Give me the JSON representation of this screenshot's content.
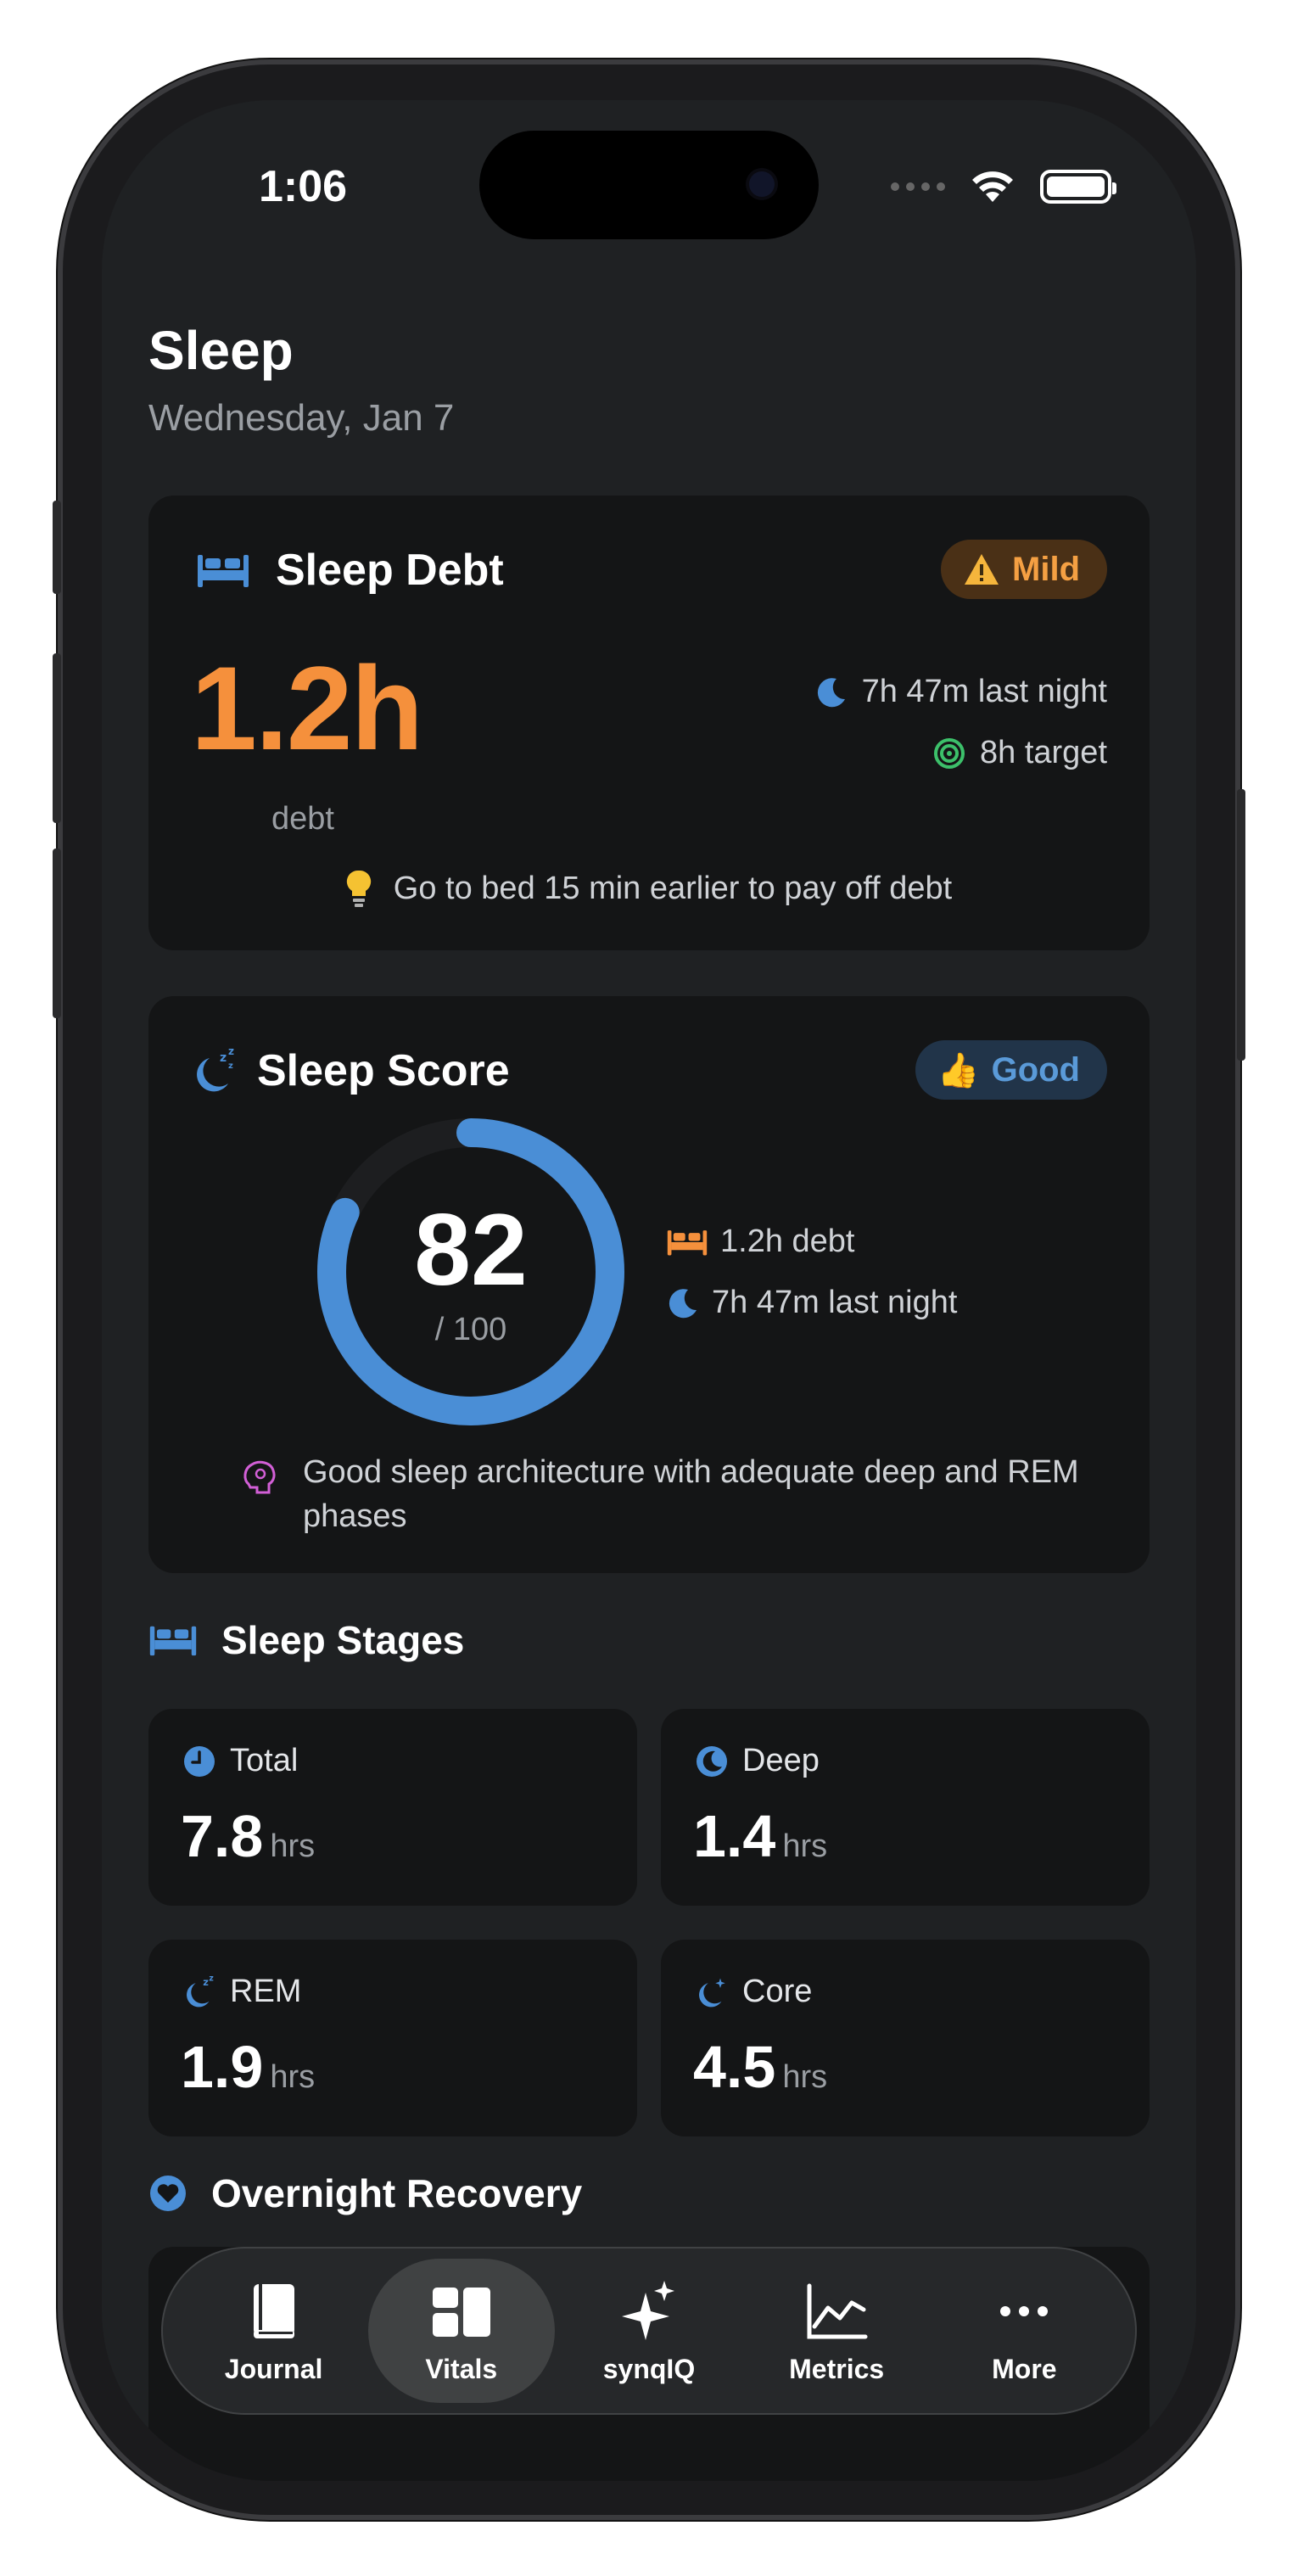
{
  "status_bar": {
    "time": "1:06"
  },
  "header": {
    "title": "Sleep",
    "date": "Wednesday, Jan 7"
  },
  "sleep_debt": {
    "title": "Sleep Debt",
    "badge": "Mild",
    "value": "1.2h",
    "value_label": "debt",
    "last_night": "7h 47m last night",
    "target": "8h target",
    "tip": "Go to bed 15 min earlier to pay off debt"
  },
  "sleep_score": {
    "title": "Sleep Score",
    "badge": "Good",
    "score": "82",
    "score_max": "/ 100",
    "score_fraction": 0.82,
    "debt": "1.2h debt",
    "last_night": "7h 47m last night",
    "insight": "Good sleep architecture with adequate deep and REM phases"
  },
  "sleep_stages": {
    "title": "Sleep Stages",
    "items": [
      {
        "label": "Total",
        "value": "7.8",
        "unit": "hrs"
      },
      {
        "label": "Deep",
        "value": "1.4",
        "unit": "hrs"
      },
      {
        "label": "REM",
        "value": "1.9",
        "unit": "hrs"
      },
      {
        "label": "Core",
        "value": "4.5",
        "unit": "hrs"
      }
    ]
  },
  "recovery": {
    "title": "Overnight Recovery"
  },
  "tabbar": {
    "items": [
      {
        "label": "Journal",
        "icon": "book-icon"
      },
      {
        "label": "Vitals",
        "icon": "dashboard-icon",
        "active": true
      },
      {
        "label": "synqIQ",
        "icon": "sparkles-icon"
      },
      {
        "label": "Metrics",
        "icon": "chart-icon"
      },
      {
        "label": "More",
        "icon": "ellipsis-icon"
      }
    ]
  },
  "colors": {
    "accent_blue": "#4a8ed6",
    "accent_orange": "#f5903c",
    "background": "#1f2123",
    "card": "#141516"
  }
}
